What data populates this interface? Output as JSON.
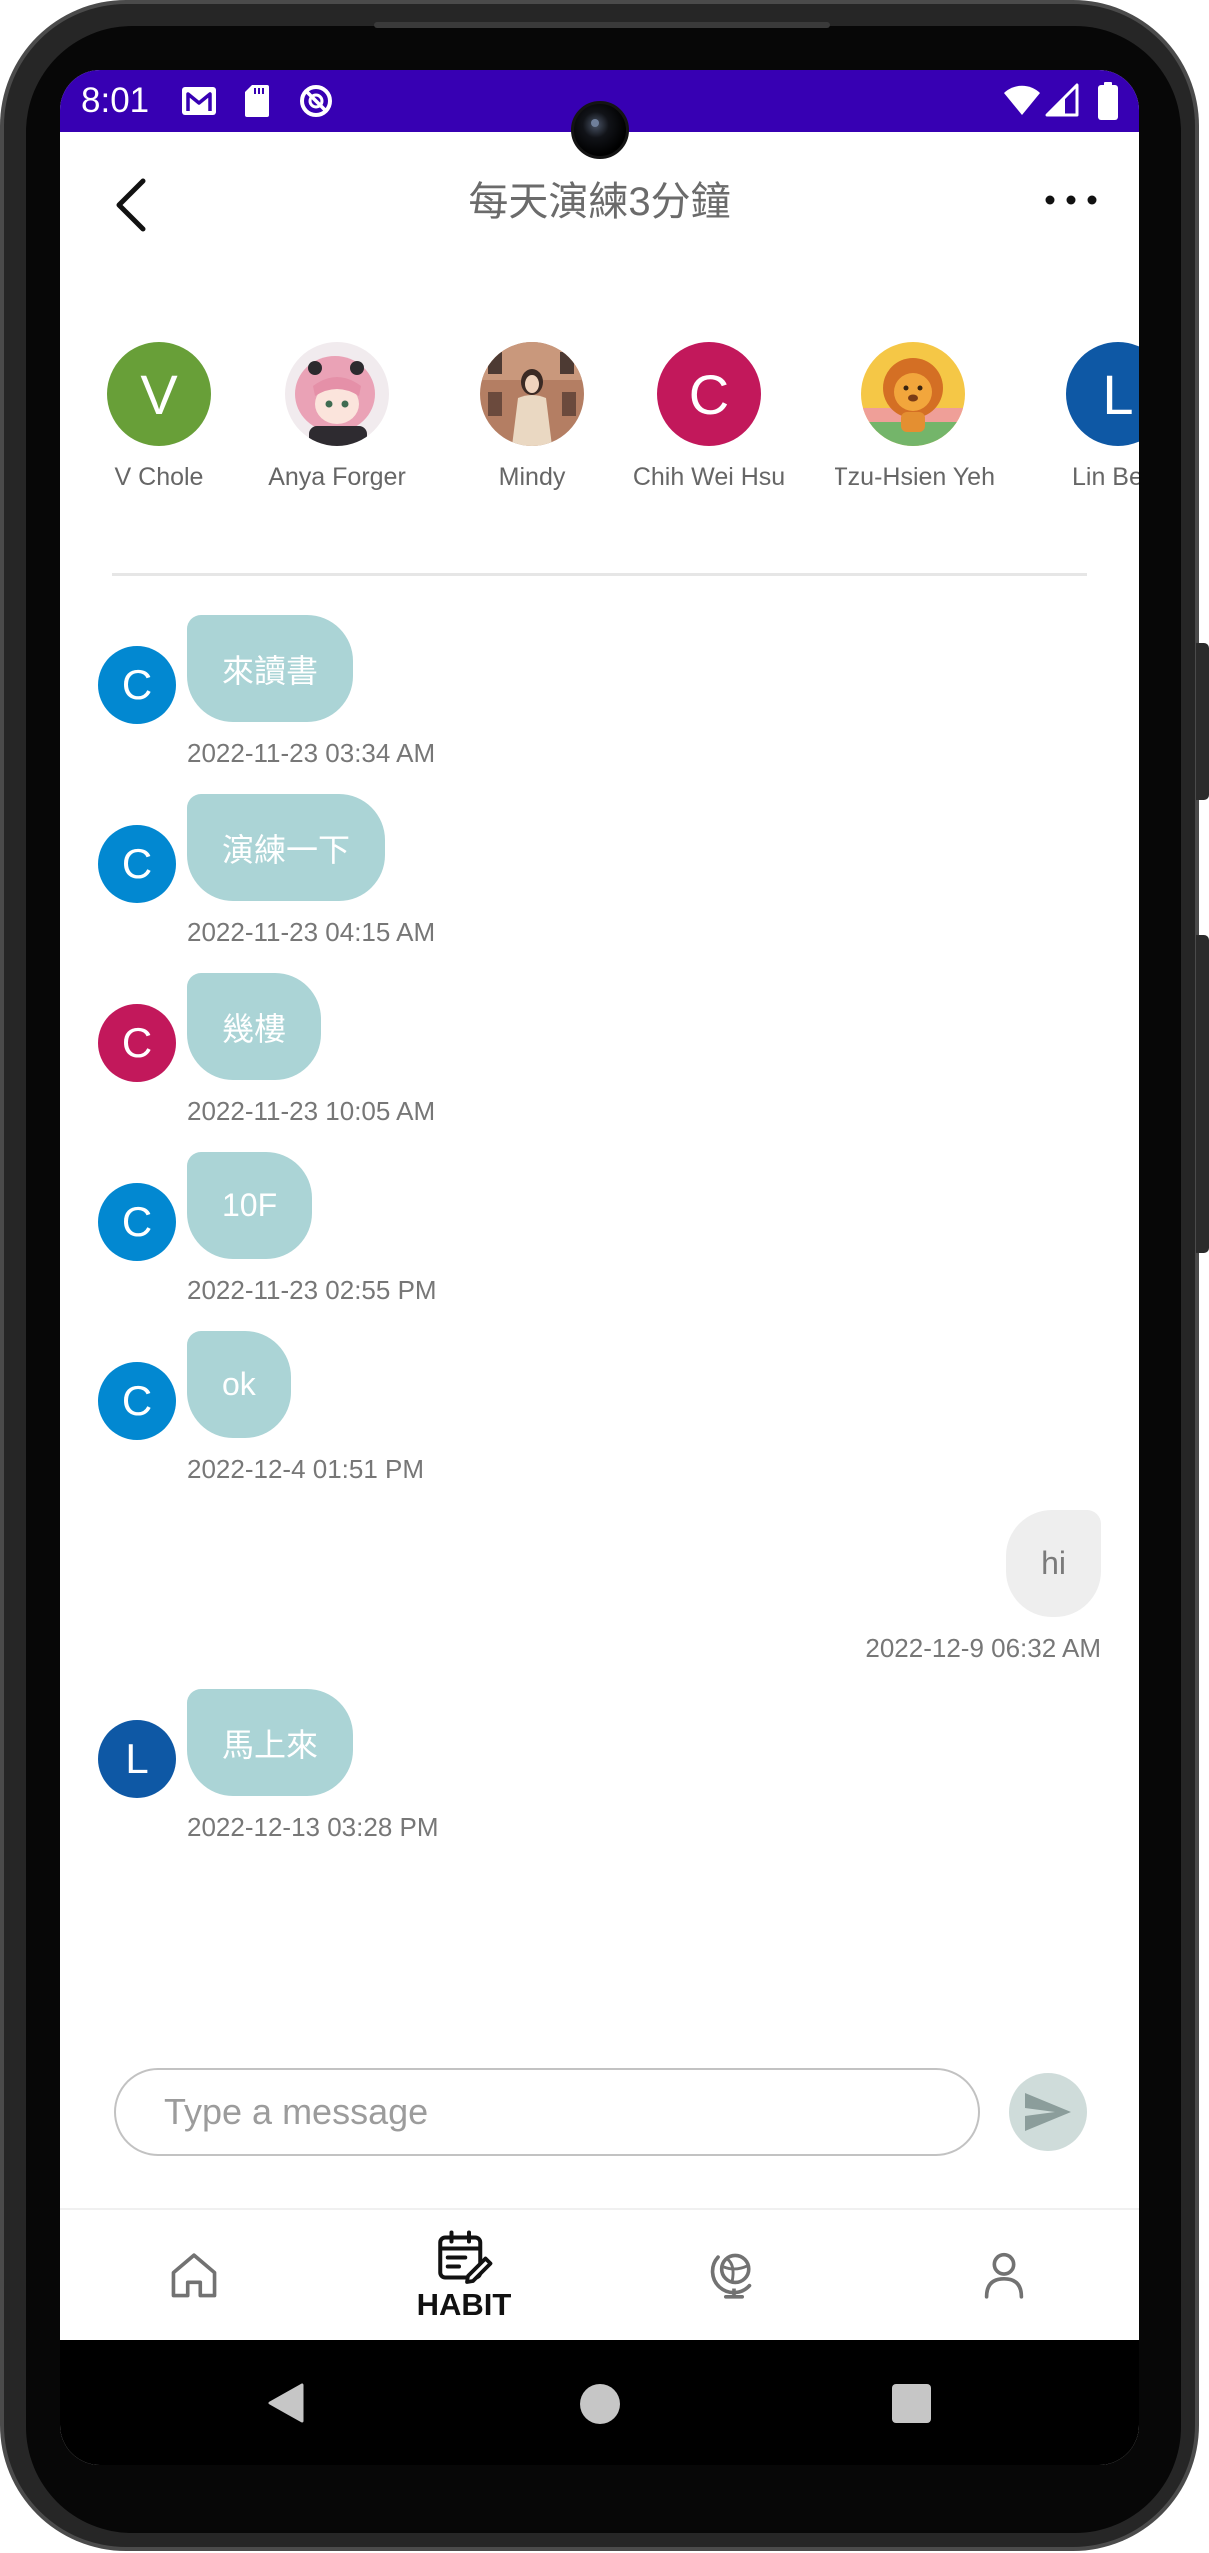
{
  "status_bar": {
    "time": "8:01",
    "left_icons": [
      "gmail-icon",
      "sd-card-icon",
      "data-saver-icon"
    ],
    "right_icons": [
      "wifi-icon",
      "signal-icon",
      "battery-icon"
    ]
  },
  "header": {
    "title": "每天演練3分鐘",
    "back_icon": "chevron-left-icon",
    "more_icon": "more-horizontal-icon"
  },
  "members": [
    {
      "name": "V Chole",
      "initial": "V",
      "color": "#689F38"
    },
    {
      "name": "Anya Forger",
      "avatar_icon": "anime-photo-avatar"
    },
    {
      "name": "Mindy",
      "avatar_icon": "portrait-photo-avatar"
    },
    {
      "name": "Chih Wei Hsu",
      "initial": "C",
      "color": "#C2185B"
    },
    {
      "name": "Tzu-Hsien Yeh",
      "avatar_icon": "lion-illustration-avatar"
    },
    {
      "name": "Lin Be",
      "initial": "L",
      "color": "#0E58A5"
    }
  ],
  "messages": [
    {
      "mine": false,
      "initial": "C",
      "avatar_color": "#0288D1",
      "text": "來讀書",
      "time": "2022-11-23 03:34 AM"
    },
    {
      "mine": false,
      "initial": "C",
      "avatar_color": "#0288D1",
      "text": "演練一下",
      "time": "2022-11-23 04:15 AM"
    },
    {
      "mine": false,
      "initial": "C",
      "avatar_color": "#C2185B",
      "text": "幾樓",
      "time": "2022-11-23 10:05 AM"
    },
    {
      "mine": false,
      "initial": "C",
      "avatar_color": "#0288D1",
      "text": "10F",
      "time": "2022-11-23 02:55 PM"
    },
    {
      "mine": false,
      "initial": "C",
      "avatar_color": "#0288D1",
      "text": "ok",
      "time": "2022-12-4 01:51 PM"
    },
    {
      "mine": true,
      "text": "hi",
      "time": "2022-12-9 06:32 AM"
    },
    {
      "mine": false,
      "initial": "L",
      "avatar_color": "#0E58A5",
      "text": "馬上來",
      "time": "2022-12-13 03:28 PM"
    }
  ],
  "composer": {
    "placeholder": "Type a message",
    "send_icon": "send-icon"
  },
  "bottom_nav": {
    "items": [
      {
        "icon": "home-icon"
      },
      {
        "icon": "habit-calendar-icon",
        "label": "HABIT",
        "active": true
      },
      {
        "icon": "globe-icon"
      },
      {
        "icon": "profile-icon"
      }
    ]
  },
  "system_nav": {
    "back_icon": "back-triangle-icon",
    "home_icon": "home-circle-icon",
    "recents_icon": "recents-square-icon"
  },
  "colors": {
    "status_bar": "#3700B3",
    "bubble_received": "#ABD4D6",
    "bubble_sent": "#EEEEEE",
    "title_text": "#6B6B6B",
    "active_nav": "#111111"
  }
}
